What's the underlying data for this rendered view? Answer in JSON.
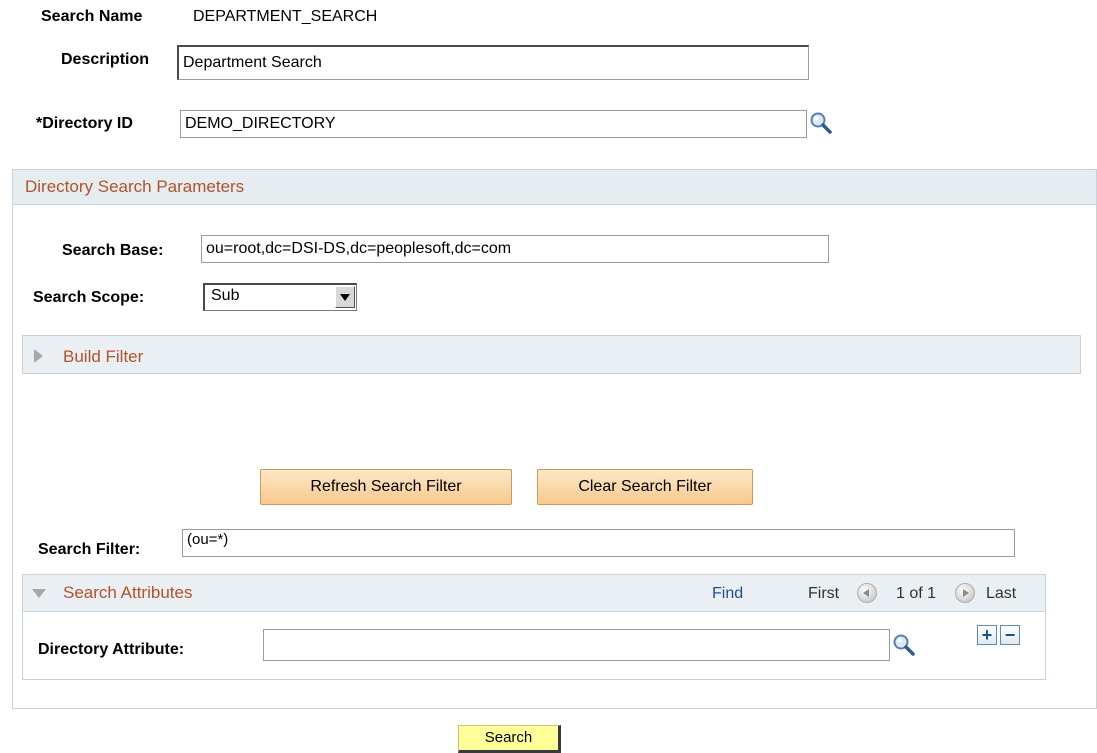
{
  "search_name": {
    "label": "Search Name",
    "value": "DEPARTMENT_SEARCH"
  },
  "description": {
    "label": "Description",
    "value": "Department Search"
  },
  "directory_id": {
    "label": "*Directory ID",
    "value": "DEMO_DIRECTORY"
  },
  "params": {
    "title": "Directory Search Parameters",
    "search_base": {
      "label": "Search Base:",
      "value": "ou=root,dc=DSI-DS,dc=peoplesoft,dc=com"
    },
    "search_scope": {
      "label": "Search Scope:",
      "value": "Sub"
    },
    "build_filter": {
      "title": "Build Filter"
    },
    "refresh_label": "Refresh Search Filter",
    "clear_label": "Clear Search Filter",
    "search_filter": {
      "label": "Search Filter:",
      "value": "(ou=*)"
    },
    "attributes": {
      "title": "Search Attributes",
      "find": "Find",
      "first": "First",
      "range": "1 of 1",
      "last": "Last",
      "attr_label": "Directory Attribute:",
      "attr_value": ""
    }
  },
  "search_button": "Search",
  "colors": {
    "section_title": "#b3522b",
    "link": "#1f4e96",
    "button": "#f8c98e",
    "search_button": "#ffff99"
  }
}
